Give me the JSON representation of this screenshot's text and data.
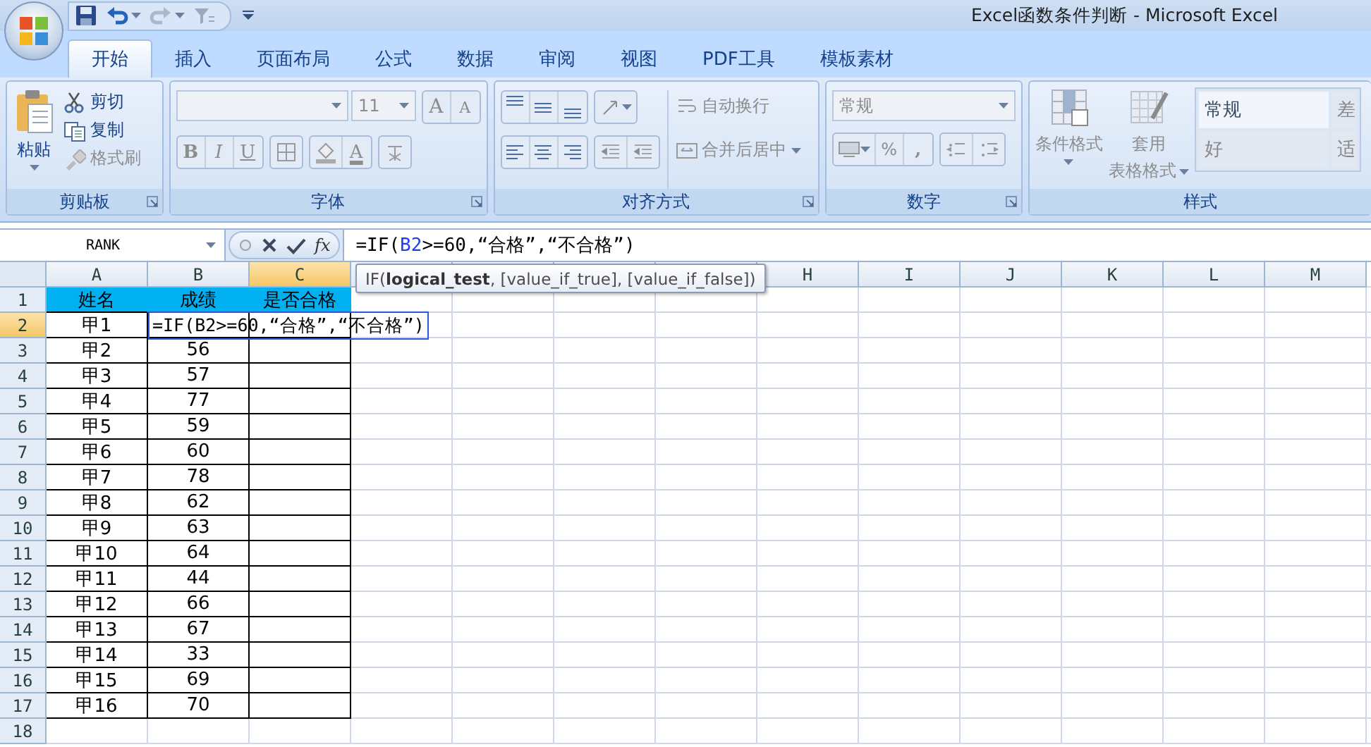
{
  "window": {
    "title": "Excel函数条件判断 - Microsoft Excel"
  },
  "tabs": [
    {
      "label": "开始",
      "selected": true
    },
    {
      "label": "插入",
      "selected": false
    },
    {
      "label": "页面布局",
      "selected": false
    },
    {
      "label": "公式",
      "selected": false
    },
    {
      "label": "数据",
      "selected": false
    },
    {
      "label": "审阅",
      "selected": false
    },
    {
      "label": "视图",
      "selected": false
    },
    {
      "label": "PDF工具",
      "selected": false
    },
    {
      "label": "模板素材",
      "selected": false
    }
  ],
  "ribbon": {
    "clipboard": {
      "title": "剪贴板",
      "paste": {
        "label": "粘贴",
        "disabled": false
      },
      "cut": {
        "label": "剪切",
        "disabled": false
      },
      "copy": {
        "label": "复制",
        "disabled": false
      },
      "format_painter": {
        "label": "格式刷",
        "disabled": true
      }
    },
    "font": {
      "title": "字体",
      "font_size": "11",
      "grow": "A",
      "shrink": "A",
      "bold": "B",
      "italic": "I",
      "underline": "U",
      "font_color": "A"
    },
    "alignment": {
      "title": "对齐方式",
      "wrap_text": {
        "label": "自动换行",
        "disabled": true
      },
      "merge_center": {
        "label": "合并后居中",
        "disabled": true
      }
    },
    "number": {
      "title": "数字",
      "format": "常规",
      "percent": "%",
      "comma": ","
    },
    "styles": {
      "title": "样式",
      "conditional_format": {
        "label": "条件格式",
        "disabled": true
      },
      "table_format": {
        "label_1": "套用",
        "label_2": "表格格式",
        "disabled": true
      },
      "cell_styles": [
        {
          "label": "常规",
          "selected": true
        },
        {
          "label": "差",
          "selected": false
        },
        {
          "label": "好",
          "selected": false
        },
        {
          "label": "适",
          "selected": false
        }
      ]
    }
  },
  "formula_bar": {
    "name_box": "RANK",
    "function_button": "fx",
    "formula": [
      {
        "text": "=IF(",
        "ref": false
      },
      {
        "text": "B2",
        "ref": true
      },
      {
        "text": ">=60,“合格”,“不合格”)",
        "ref": false
      }
    ]
  },
  "sheet": {
    "columns": [
      {
        "label": "A",
        "selected": false
      },
      {
        "label": "B",
        "selected": false
      },
      {
        "label": "C",
        "selected": true
      },
      {
        "selected": false
      },
      {
        "selected": false
      },
      {
        "selected": false
      },
      {
        "selected": false
      },
      {
        "label": "H",
        "selected": false
      },
      {
        "label": "I",
        "selected": false
      },
      {
        "label": "J",
        "selected": false
      },
      {
        "label": "K",
        "selected": false
      },
      {
        "label": "L",
        "selected": false
      },
      {
        "label": "M",
        "selected": false
      }
    ],
    "tooltip": "IF(**logical_test**, [value_if_true], [value_if_false])",
    "editor": {
      "text": "=IF(B2>=60,“合格”,“不合格”)"
    },
    "rows": [
      {
        "header": "1",
        "selected": false,
        "cells": [
          {
            "kind": "header",
            "text": "姓名"
          },
          {
            "kind": "header",
            "text": "成绩"
          },
          {
            "kind": "header",
            "text": "是否合格"
          }
        ]
      },
      {
        "header": "2",
        "selected": true,
        "cells": [
          {
            "kind": "data",
            "text": "甲1"
          },
          {
            "kind": "data",
            "editing": true
          },
          {
            "kind": "data"
          }
        ]
      },
      {
        "header": "3",
        "selected": false,
        "cells": [
          {
            "kind": "data",
            "text": "甲2"
          },
          {
            "kind": "data",
            "text": "56"
          },
          {
            "kind": "data"
          }
        ]
      },
      {
        "header": "4",
        "selected": false,
        "cells": [
          {
            "kind": "data",
            "text": "甲3"
          },
          {
            "kind": "data",
            "text": "57"
          },
          {
            "kind": "data"
          }
        ]
      },
      {
        "header": "5",
        "selected": false,
        "cells": [
          {
            "kind": "data",
            "text": "甲4"
          },
          {
            "kind": "data",
            "text": "77"
          },
          {
            "kind": "data"
          }
        ]
      },
      {
        "header": "6",
        "selected": false,
        "cells": [
          {
            "kind": "data",
            "text": "甲5"
          },
          {
            "kind": "data",
            "text": "59"
          },
          {
            "kind": "data"
          }
        ]
      },
      {
        "header": "7",
        "selected": false,
        "cells": [
          {
            "kind": "data",
            "text": "甲6"
          },
          {
            "kind": "data",
            "text": "60"
          },
          {
            "kind": "data"
          }
        ]
      },
      {
        "header": "8",
        "selected": false,
        "cells": [
          {
            "kind": "data",
            "text": "甲7"
          },
          {
            "kind": "data",
            "text": "78"
          },
          {
            "kind": "data"
          }
        ]
      },
      {
        "header": "9",
        "selected": false,
        "cells": [
          {
            "kind": "data",
            "text": "甲8"
          },
          {
            "kind": "data",
            "text": "62"
          },
          {
            "kind": "data"
          }
        ]
      },
      {
        "header": "10",
        "selected": false,
        "cells": [
          {
            "kind": "data",
            "text": "甲9"
          },
          {
            "kind": "data",
            "text": "63"
          },
          {
            "kind": "data"
          }
        ]
      },
      {
        "header": "11",
        "selected": false,
        "cells": [
          {
            "kind": "data",
            "text": "甲10"
          },
          {
            "kind": "data",
            "text": "64"
          },
          {
            "kind": "data"
          }
        ]
      },
      {
        "header": "12",
        "selected": false,
        "cells": [
          {
            "kind": "data",
            "text": "甲11"
          },
          {
            "kind": "data",
            "text": "44"
          },
          {
            "kind": "data"
          }
        ]
      },
      {
        "header": "13",
        "selected": false,
        "cells": [
          {
            "kind": "data",
            "text": "甲12"
          },
          {
            "kind": "data",
            "text": "66"
          },
          {
            "kind": "data"
          }
        ]
      },
      {
        "header": "14",
        "selected": false,
        "cells": [
          {
            "kind": "data",
            "text": "甲13"
          },
          {
            "kind": "data",
            "text": "67"
          },
          {
            "kind": "data"
          }
        ]
      },
      {
        "header": "15",
        "selected": false,
        "cells": [
          {
            "kind": "data",
            "text": "甲14"
          },
          {
            "kind": "data",
            "text": "33"
          },
          {
            "kind": "data"
          }
        ]
      },
      {
        "header": "16",
        "selected": false,
        "cells": [
          {
            "kind": "data",
            "text": "甲15"
          },
          {
            "kind": "data",
            "text": "69"
          },
          {
            "kind": "data"
          }
        ]
      },
      {
        "header": "17",
        "selected": false,
        "cells": [
          {
            "kind": "data",
            "text": "甲16"
          },
          {
            "kind": "data",
            "text": "70"
          },
          {
            "kind": "data"
          }
        ]
      },
      {
        "header": "18",
        "selected": false,
        "cells": []
      }
    ]
  }
}
